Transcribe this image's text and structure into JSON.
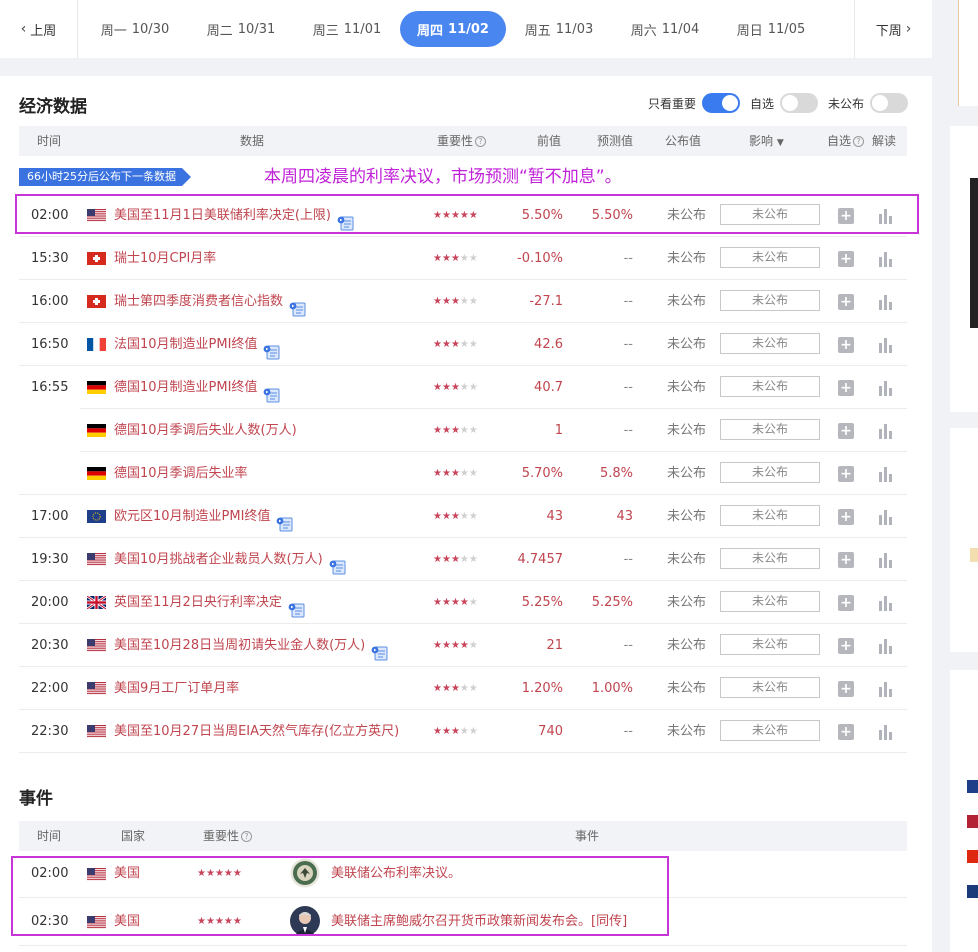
{
  "week_nav": {
    "prev_label": "上周",
    "next_label": "下周",
    "days": [
      {
        "weekday": "周一",
        "date": "10/30",
        "active": false
      },
      {
        "weekday": "周二",
        "date": "10/31",
        "active": false
      },
      {
        "weekday": "周三",
        "date": "11/01",
        "active": false
      },
      {
        "weekday": "周四",
        "date": "11/02",
        "active": true
      },
      {
        "weekday": "周五",
        "date": "11/03",
        "active": false
      },
      {
        "weekday": "周六",
        "date": "11/04",
        "active": false
      },
      {
        "weekday": "周日",
        "date": "11/05",
        "active": false
      }
    ]
  },
  "econ": {
    "title": "经济数据",
    "filters": [
      {
        "label": "只看重要",
        "on": true
      },
      {
        "label": "自选",
        "on": false
      },
      {
        "label": "未公布",
        "on": false
      }
    ],
    "headers": {
      "time": "时间",
      "data": "数据",
      "importance": "重要性",
      "previous": "前值",
      "forecast": "预测值",
      "actual": "公布值",
      "impact": "影响",
      "watch": "自选",
      "interpret": "解读"
    },
    "countdown": "66小时25分后公布下一条数据",
    "annotation": "本周四凌晨的利率决议，市场预测“暂不加息”。",
    "rows": [
      {
        "time": "02:00",
        "flag": "us",
        "name": "美国至11月1日美联储利率决定(上限)",
        "doc": true,
        "stars": 5,
        "previous": "5.50%",
        "forecast": "5.50%",
        "actual": "未公布",
        "impact": "未公布"
      },
      {
        "time": "15:30",
        "flag": "ch",
        "name": "瑞士10月CPI月率",
        "doc": false,
        "stars": 3,
        "previous": "-0.10%",
        "forecast": "--",
        "actual": "未公布",
        "impact": "未公布"
      },
      {
        "time": "16:00",
        "flag": "ch",
        "name": "瑞士第四季度消费者信心指数",
        "doc": true,
        "stars": 3,
        "previous": "-27.1",
        "forecast": "--",
        "actual": "未公布",
        "impact": "未公布"
      },
      {
        "time": "16:50",
        "flag": "fr",
        "name": "法国10月制造业PMI终值",
        "doc": true,
        "stars": 3,
        "previous": "42.6",
        "forecast": "--",
        "actual": "未公布",
        "impact": "未公布"
      },
      {
        "time": "16:55",
        "flag": "de",
        "name": "德国10月制造业PMI终值",
        "doc": true,
        "stars": 3,
        "previous": "40.7",
        "forecast": "--",
        "actual": "未公布",
        "impact": "未公布"
      },
      {
        "time": "",
        "flag": "de",
        "name": "德国10月季调后失业人数(万人)",
        "doc": false,
        "stars": 3,
        "previous": "1",
        "forecast": "--",
        "actual": "未公布",
        "impact": "未公布"
      },
      {
        "time": "",
        "flag": "de",
        "name": "德国10月季调后失业率",
        "doc": false,
        "stars": 3,
        "previous": "5.70%",
        "forecast": "5.8%",
        "actual": "未公布",
        "impact": "未公布"
      },
      {
        "time": "17:00",
        "flag": "eu",
        "name": "欧元区10月制造业PMI终值",
        "doc": true,
        "stars": 3,
        "previous": "43",
        "forecast": "43",
        "actual": "未公布",
        "impact": "未公布"
      },
      {
        "time": "19:30",
        "flag": "us",
        "name": "美国10月挑战者企业裁员人数(万人)",
        "doc": true,
        "stars": 3,
        "previous": "4.7457",
        "forecast": "--",
        "actual": "未公布",
        "impact": "未公布"
      },
      {
        "time": "20:00",
        "flag": "uk",
        "name": "英国至11月2日央行利率决定",
        "doc": true,
        "stars": 4,
        "previous": "5.25%",
        "forecast": "5.25%",
        "actual": "未公布",
        "impact": "未公布"
      },
      {
        "time": "20:30",
        "flag": "us",
        "name": "美国至10月28日当周初请失业金人数(万人)",
        "doc": true,
        "stars": 4,
        "previous": "21",
        "forecast": "--",
        "actual": "未公布",
        "impact": "未公布"
      },
      {
        "time": "22:00",
        "flag": "us",
        "name": "美国9月工厂订单月率",
        "doc": false,
        "stars": 3,
        "previous": "1.20%",
        "forecast": "1.00%",
        "actual": "未公布",
        "impact": "未公布"
      },
      {
        "time": "22:30",
        "flag": "us",
        "name": "美国至10月27日当周EIA天然气库存(亿立方英尺)",
        "doc": false,
        "stars": 3,
        "previous": "740",
        "forecast": "--",
        "actual": "未公布",
        "impact": "未公布"
      }
    ]
  },
  "events": {
    "title": "事件",
    "headers": {
      "time": "时间",
      "country": "国家",
      "importance": "重要性",
      "event": "事件"
    },
    "rows": [
      {
        "time": "02:00",
        "flag": "us",
        "country": "美国",
        "stars": 5,
        "avatar": "fed-seal",
        "text": "美联储公布利率决议。"
      },
      {
        "time": "02:30",
        "flag": "us",
        "country": "美国",
        "stars": 5,
        "avatar": "person",
        "text": "美联储主席鲍威尔召开货币政策新闻发布会。[同传]"
      }
    ]
  },
  "colors": {
    "accent": "#4a86f0",
    "highlight": "#c934d8",
    "value_red": "#c0454f",
    "star": "#c9455b"
  }
}
